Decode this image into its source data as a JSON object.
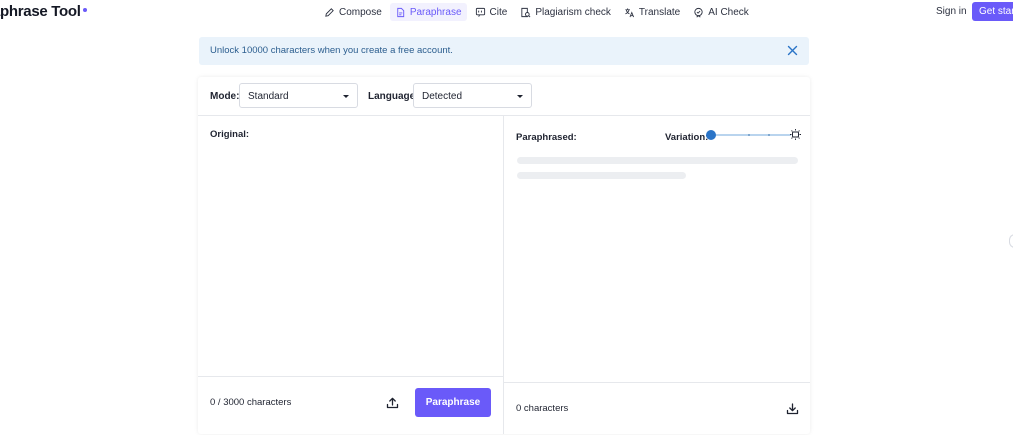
{
  "header": {
    "logo": "aphrase Tool",
    "nav": [
      {
        "label": "Compose",
        "icon": "pencil-icon",
        "active": false
      },
      {
        "label": "Paraphrase",
        "icon": "document-icon",
        "active": true
      },
      {
        "label": "Cite",
        "icon": "quote-icon",
        "active": false
      },
      {
        "label": "Plagiarism check",
        "icon": "document-search-icon",
        "active": false
      },
      {
        "label": "Translate",
        "icon": "translate-icon",
        "active": false
      },
      {
        "label": "AI Check",
        "icon": "shield-check-icon",
        "active": false
      }
    ],
    "sign_in": "Sign in",
    "get_started": "Get started"
  },
  "banner": {
    "text": "Unlock 10000 characters when you create a free account.",
    "close_icon": "close-icon"
  },
  "controls": {
    "mode_label": "Mode:",
    "mode_value": "Standard",
    "language_label": "Language:",
    "language_value": "Detected"
  },
  "original": {
    "label": "Original:",
    "value": "",
    "char_count": "0 / 3000 characters",
    "upload_icon": "upload-icon",
    "button": "Paraphrase"
  },
  "paraphrased": {
    "label": "Paraphrased:",
    "variation_label": "Variation:",
    "variation_level": 0,
    "char_count": "0 characters",
    "download_icon": "download-icon"
  },
  "colors": {
    "accent": "#6a5af9",
    "banner_bg": "#eaf3fb",
    "banner_text": "#2c5e8f",
    "slider": "#2a74c7"
  }
}
